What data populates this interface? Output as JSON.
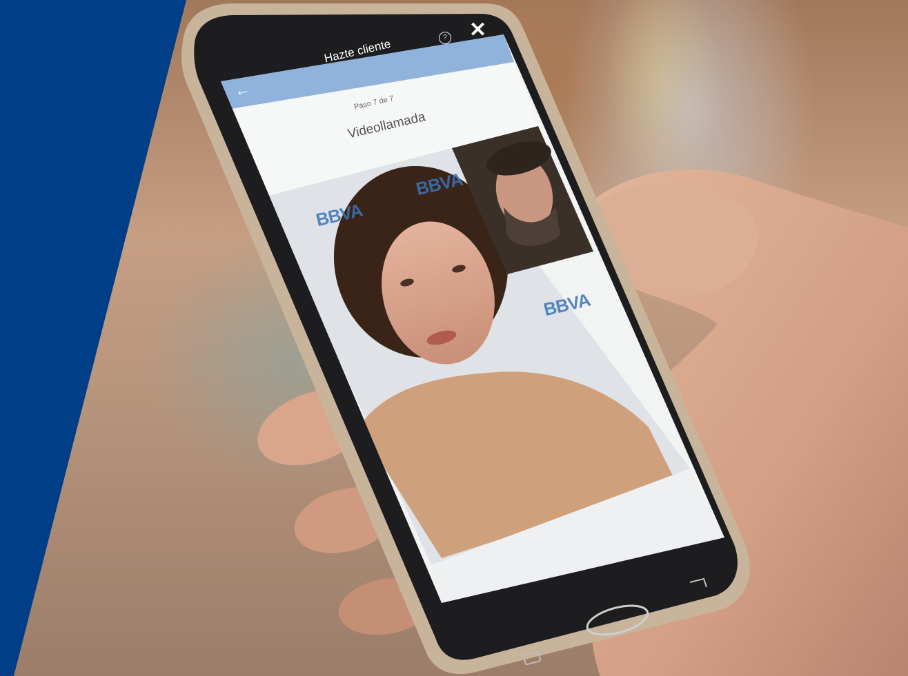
{
  "app": {
    "header_title": "Hazte cliente",
    "step_label": "Paso 7 de 7",
    "screen_title": "Videollamada",
    "back_icon": "arrow-left-icon",
    "help_icon": "help-circle-icon",
    "help_glyph": "?",
    "close_icon": "close-icon",
    "back_glyph": "←",
    "close_glyph": "✕"
  },
  "watermark": {
    "brand": "BBVA"
  },
  "colors": {
    "panel_blue": "#003f87",
    "header_blue": "#8fb3dc",
    "phone_frame": "#1d1d1f"
  }
}
